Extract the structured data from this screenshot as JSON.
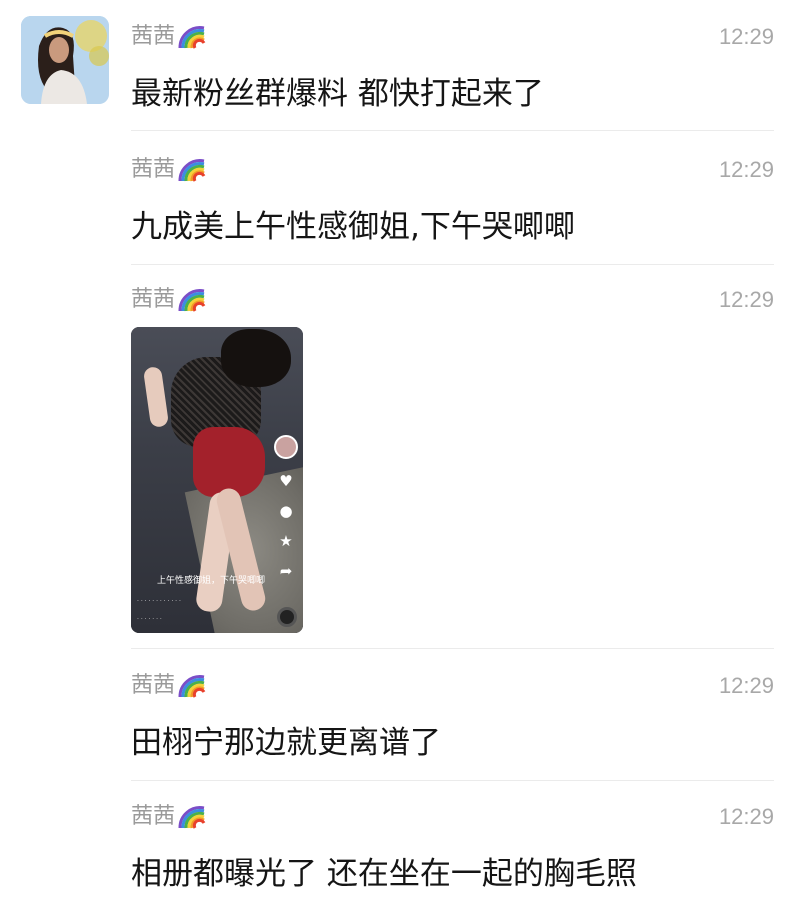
{
  "chat": {
    "avatar_icon": "user-avatar",
    "accent_rainbow": [
      "#e8412c",
      "#f29b28",
      "#f4d23a",
      "#4bb04a",
      "#3a8ee0",
      "#7b4ec8"
    ],
    "messages": [
      {
        "sender": "茜茜",
        "time": "12:29",
        "text": "最新粉丝群爆料 都快打起来了"
      },
      {
        "sender": "茜茜",
        "time": "12:29",
        "text": "九成美上午性感御姐,下午哭唧唧"
      },
      {
        "sender": "茜茜",
        "time": "12:29",
        "video_caption": "上午性感御姐，下午哭唧唧"
      },
      {
        "sender": "茜茜",
        "time": "12:29",
        "text": "田栩宁那边就更离谱了"
      },
      {
        "sender": "茜茜",
        "time": "12:29",
        "text": "相册都曝光了 还在坐在一起的胸毛照"
      }
    ]
  }
}
